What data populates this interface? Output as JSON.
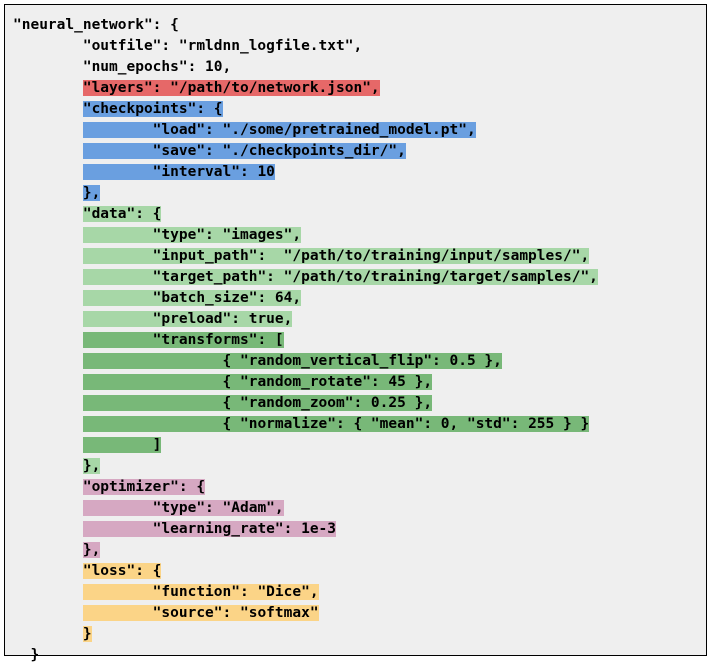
{
  "code": {
    "root_key": "\"neural_network\": {",
    "outfile": "        \"outfile\": \"rmldnn_logfile.txt\",",
    "num_epochs": "        \"num_epochs\": 10,",
    "layers": "\"layers\": \"/path/to/network.json\",",
    "checkpoints_open": "\"checkpoints\": {",
    "checkpoints_load": "        \"load\": \"./some/pretrained_model.pt\",",
    "checkpoints_save": "        \"save\": \"./checkpoints_dir/\",",
    "checkpoints_interval": "        \"interval\": 10",
    "checkpoints_close": "},",
    "data_open": "\"data\": {",
    "data_type": "        \"type\": \"images\",",
    "data_input_path": "        \"input_path\":  \"/path/to/training/input/samples/\",",
    "data_target_path": "        \"target_path\": \"/path/to/training/target/samples/\",",
    "data_batch_size": "        \"batch_size\": 64,",
    "data_preload": "        \"preload\": true,",
    "data_transforms_open": "        \"transforms\": [",
    "data_tf_pad": "                ",
    "data_tf_flip": "{ \"random_vertical_flip\": 0.5 },",
    "data_tf_rotate": "{ \"random_rotate\": 45 },",
    "data_tf_zoom": "{ \"random_zoom\": 0.25 },",
    "data_tf_norm": "{ \"normalize\": { \"mean\": 0, \"std\": 255 } }",
    "data_transforms_close": "        ]",
    "data_close": "},",
    "optimizer_open": "\"optimizer\": {",
    "optimizer_type": "        \"type\": \"Adam\",",
    "optimizer_lr": "        \"learning_rate\": 1e-3",
    "optimizer_close": "},",
    "loss_open": "\"loss\": {",
    "loss_function": "        \"function\": \"Dice\",",
    "loss_source": "        \"source\": \"softmax\"",
    "loss_close": "}",
    "root_close": "}",
    "indent_4": "        ",
    "indent_1": "  "
  }
}
